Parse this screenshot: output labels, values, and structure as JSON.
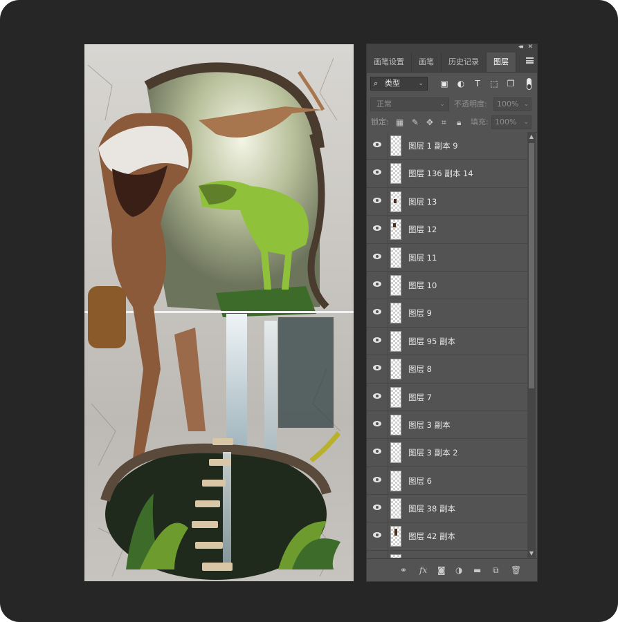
{
  "panel": {
    "tabs": [
      {
        "label": "画笔设置",
        "active": false
      },
      {
        "label": "画笔",
        "active": false
      },
      {
        "label": "历史记录",
        "active": false
      },
      {
        "label": "图层",
        "active": true
      }
    ],
    "filter": {
      "value": "类型"
    },
    "blend_mode": "正常",
    "opacity_label": "不透明度:",
    "opacity_value": "100%",
    "lock_label": "锁定:",
    "fill_label": "填充:",
    "fill_value": "100%",
    "layers": [
      {
        "name": "图层 1 副本 9",
        "visible": true
      },
      {
        "name": "图层 136 副本 14",
        "visible": true
      },
      {
        "name": "图层 13",
        "visible": true
      },
      {
        "name": "图层 12",
        "visible": true
      },
      {
        "name": "图层 11",
        "visible": true
      },
      {
        "name": "图层 10",
        "visible": true
      },
      {
        "name": "图层 9",
        "visible": true
      },
      {
        "name": "图层 95 副本",
        "visible": true
      },
      {
        "name": "图层 8",
        "visible": true
      },
      {
        "name": "图层 7",
        "visible": true
      },
      {
        "name": "图层 3 副本",
        "visible": true
      },
      {
        "name": "图层 3 副本 2",
        "visible": true
      },
      {
        "name": "图层 6",
        "visible": true
      },
      {
        "name": "图层 38 副本",
        "visible": true
      },
      {
        "name": "图层 42 副本",
        "visible": true
      },
      {
        "name": "",
        "visible": true
      }
    ],
    "footer_icons": [
      "link-icon",
      "fx-icon",
      "mask-icon",
      "adjustment-icon",
      "folder-icon",
      "new-layer-icon",
      "trash-icon"
    ]
  },
  "artwork": {
    "subject": "dinosaur-3d-wall-mural",
    "colors": {
      "wall": "#c9c6c1",
      "crack": "#4a3b2f",
      "trex": "#8a5a3a",
      "raptor": "#8fc23a",
      "jungle": "#3d6b2a",
      "waterfall": "#dfe8ec"
    }
  }
}
